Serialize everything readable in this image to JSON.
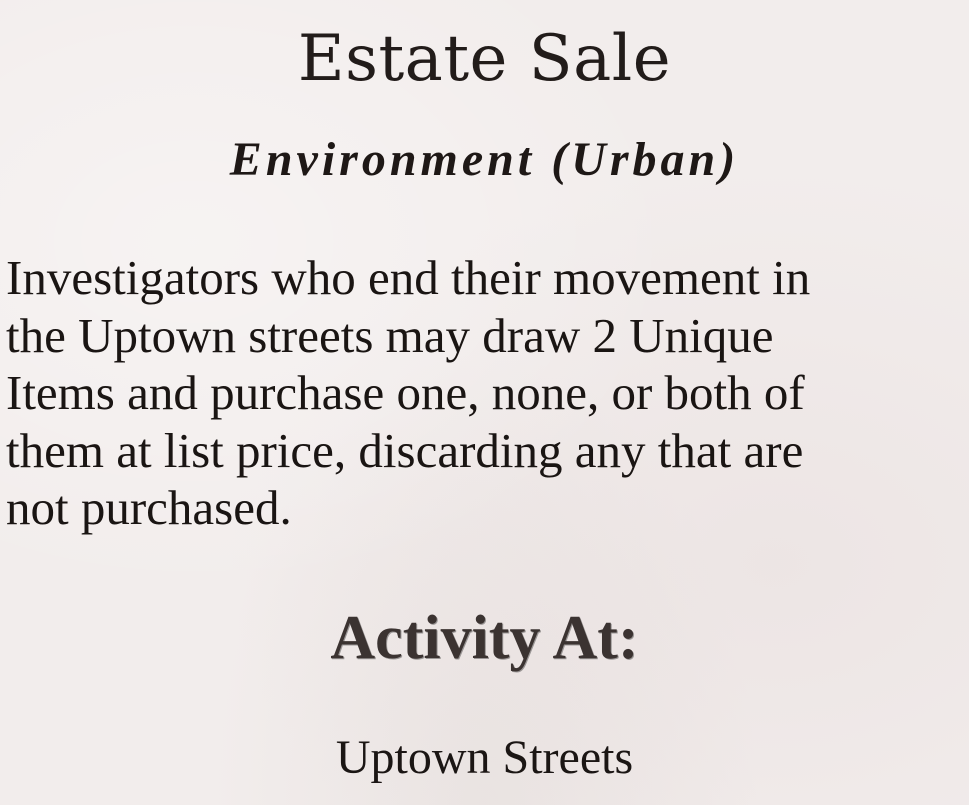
{
  "card": {
    "title": "Estate Sale",
    "subtitle": "Environment (Urban)",
    "body_lines": [
      "Investigators who end their movement in",
      "the Uptown streets may draw 2 Unique",
      "Items and purchase one, none, or both of",
      "them at list price, discarding any that are",
      "not purchased."
    ],
    "activity_heading": "Activity At:",
    "location": "Uptown Streets"
  }
}
